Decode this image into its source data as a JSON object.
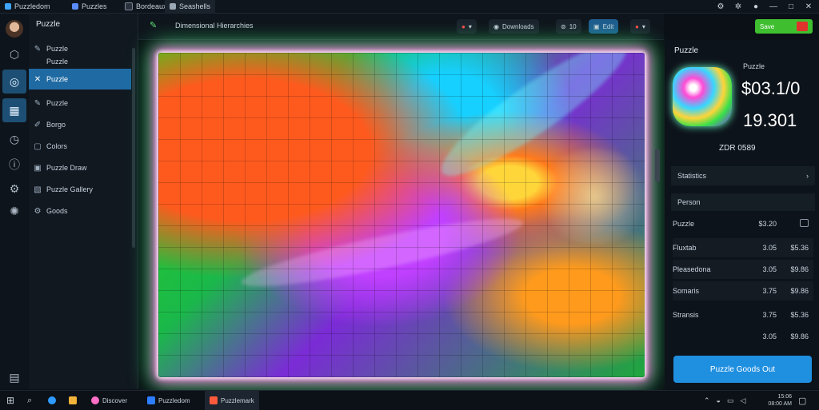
{
  "titlebar": {
    "tabs": [
      {
        "label": "Puzzledom",
        "color": "#3fa6ff"
      },
      {
        "label": "Puzzles",
        "color": "#5a8cff"
      },
      {
        "label": "Bordeaux",
        "color": "#7d8a99"
      },
      {
        "label": "Seashells",
        "color": "#9aa7b5"
      }
    ],
    "controls": {
      "minimize": "—",
      "maximize": "□",
      "close": "✕"
    }
  },
  "rail": {
    "icons": [
      "avatar",
      "cube-icon",
      "puzzle-icon",
      "grid-icon",
      "clock-icon",
      "info-icon",
      "gear-icon",
      "settings-icon",
      "panel-icon"
    ]
  },
  "sidebar": {
    "title": "Puzzle",
    "items": [
      {
        "label": "Puzzle"
      },
      {
        "label": "Puzzle"
      },
      {
        "label": "Puzzle"
      },
      {
        "label": "Puzzle"
      },
      {
        "label": "Borgo"
      },
      {
        "label": "Colors"
      },
      {
        "label": "Puzzle Draw"
      },
      {
        "label": "Puzzle Gallery"
      },
      {
        "label": "Goods"
      }
    ]
  },
  "toolbar": {
    "path": "Dimensional Hierarchies",
    "btn_save": "Downloads",
    "btn_zoom": "10",
    "btn_edit": "Edit",
    "btn_red": ""
  },
  "topright": {
    "button": "Save"
  },
  "rpanel": {
    "title": "Puzzle",
    "subtitle": "Puzzle",
    "price": "$03.1/0",
    "score": "19.301",
    "code": "ZDR 0589",
    "section": "Statistics",
    "header": "Person",
    "rows": [
      {
        "c1": "Puzzle",
        "c2": "$3.20",
        "c3": ""
      },
      {
        "c1": "Fluxtab",
        "c2": "3.05",
        "c3": "$5.36"
      },
      {
        "c1": "Pleasedona",
        "c2": "3.05",
        "c3": "$9.86"
      },
      {
        "c1": "Somaris",
        "c2": "3.75",
        "c3": "$9.86"
      },
      {
        "c1": "Stransis",
        "c2": "3.75",
        "c3": "$5.36"
      },
      {
        "c1": "",
        "c2": "3.05",
        "c3": "$9.86"
      }
    ],
    "cta": "Puzzle Goods Out"
  },
  "taskbar": {
    "items": [
      {
        "label": "Discover",
        "color": "#ff6ec7"
      },
      {
        "label": "Puzzledom",
        "color": "#2d7dff"
      },
      {
        "label": "Puzzlemark",
        "color": "#ff5a3c"
      }
    ],
    "time": "15:06",
    "date": "08:00 AM"
  }
}
